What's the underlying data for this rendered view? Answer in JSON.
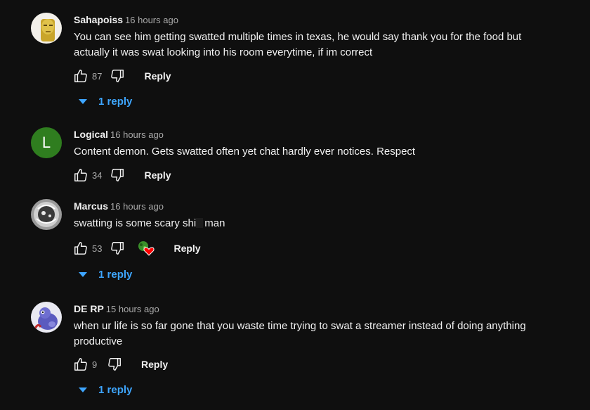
{
  "comments": [
    {
      "author": "Sahapoiss",
      "time": "16 hours ago",
      "text_line1": "You can see him getting swatted multiple times in texas, he would say thank you for the food but",
      "text_line2": "actually it was swat looking into his room everytime, if im correct",
      "likes": "87",
      "reply_label": "Reply",
      "replies_label": "1 reply"
    },
    {
      "author": "Logical",
      "time": "16 hours ago",
      "avatar_letter": "L",
      "avatar_color": "#2f7d1f",
      "text_line1": "Content demon. Gets swatted often yet chat hardly ever notices. Respect",
      "likes": "34",
      "reply_label": "Reply"
    },
    {
      "author": "Marcus",
      "time": "16 hours ago",
      "text_before": "swatting is some scary shi",
      "text_after": "man",
      "likes": "53",
      "reply_label": "Reply",
      "replies_label": "1 reply"
    },
    {
      "author": "DE RP",
      "time": "15 hours ago",
      "text_line1": "when ur life is so far gone that you waste time trying to swat a streamer instead of doing anything",
      "text_line2": "productive",
      "likes": "9",
      "reply_label": "Reply",
      "replies_label": "1 reply"
    }
  ],
  "icons": {
    "like": "thumbs-up-icon",
    "dislike": "thumbs-down-icon",
    "expand": "caret-down-icon",
    "creator_heart": "creator-heart-icon"
  },
  "colors": {
    "background": "#0f0f0f",
    "text": "#f1f1f1",
    "muted": "#aaaaaa",
    "link": "#3ea6ff",
    "heart": "#ff0000"
  }
}
